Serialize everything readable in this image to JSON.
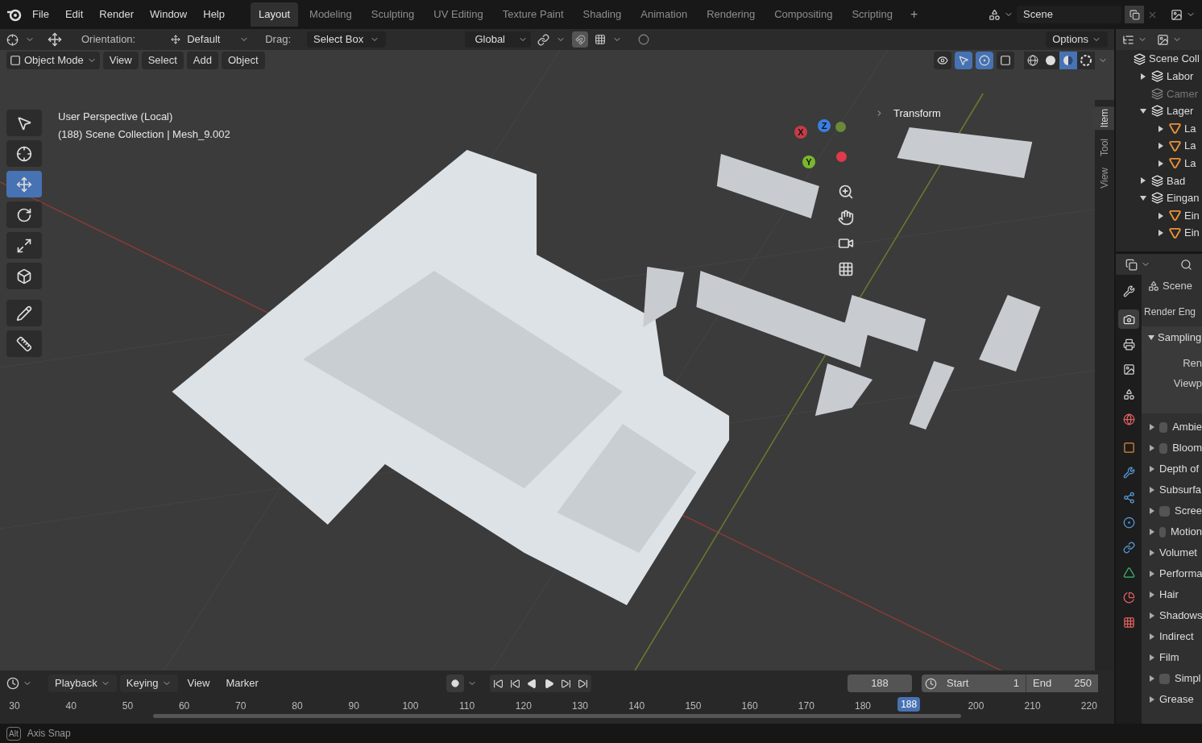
{
  "top_bar": {
    "menus": [
      "File",
      "Edit",
      "Render",
      "Window",
      "Help"
    ],
    "workspaces": [
      {
        "label": "Layout",
        "selected": true
      },
      {
        "label": "Modeling",
        "selected": false
      },
      {
        "label": "Sculpting",
        "selected": false
      },
      {
        "label": "UV Editing",
        "selected": false
      },
      {
        "label": "Texture Paint",
        "selected": false
      },
      {
        "label": "Shading",
        "selected": false
      },
      {
        "label": "Animation",
        "selected": false
      },
      {
        "label": "Rendering",
        "selected": false
      },
      {
        "label": "Compositing",
        "selected": false
      },
      {
        "label": "Scripting",
        "selected": false
      }
    ],
    "add_workspace": "+",
    "scene": "Scene"
  },
  "tool_settings": {
    "orientation_label": "Orientation:",
    "orientation": "Default",
    "drag_label": "Drag:",
    "drag": "Select Box",
    "transform_orientation": "Global",
    "snapping_on": true,
    "options": "Options"
  },
  "viewport_header": {
    "mode": "Object Mode",
    "menus": [
      "View",
      "Select",
      "Add",
      "Object"
    ],
    "toggles": [
      {
        "kind": "selectability",
        "selected": false
      },
      {
        "kind": "gizmos",
        "selected": true
      },
      {
        "kind": "overlays",
        "selected": true
      },
      {
        "kind": "xray",
        "selected": false
      }
    ],
    "shading": [
      {
        "kind": "wireframe",
        "selected": false
      },
      {
        "kind": "solid",
        "selected": false
      },
      {
        "kind": "material",
        "selected": true
      },
      {
        "kind": "rendered",
        "selected": false
      }
    ]
  },
  "toolbar": [
    {
      "kind": "select",
      "selected": false
    },
    {
      "kind": "cursor",
      "selected": false
    },
    {
      "kind": "move",
      "selected": true
    },
    {
      "kind": "rotate",
      "selected": false
    },
    {
      "kind": "scale",
      "selected": false
    },
    {
      "kind": "transform",
      "selected": false
    },
    {
      "kind": "annotate",
      "selected": false
    },
    {
      "kind": "measure",
      "selected": false
    }
  ],
  "viewport": {
    "view_name": "User Perspective (Local)",
    "info": "(188) Scene Collection | Mesh_9.002",
    "gizmo_axes": [
      "X",
      "Y",
      "Z"
    ],
    "sidebar_panel": "Transform",
    "sidebar_tabs": [
      {
        "label": "Item",
        "selected": true
      },
      {
        "label": "Tool",
        "selected": false
      },
      {
        "label": "View",
        "selected": false
      }
    ]
  },
  "outliner": {
    "root": "Scene Coll",
    "items": [
      {
        "label": "Labor",
        "kind": "collection",
        "expanded": false,
        "disabled": false
      },
      {
        "label": "Camer",
        "kind": "collection",
        "disabled": true
      },
      {
        "label": "Lager",
        "kind": "collection",
        "expanded": true,
        "disabled": false,
        "children": [
          {
            "label": "La",
            "kind": "mesh",
            "expanded": false,
            "disabled": false
          },
          {
            "label": "La",
            "kind": "mesh",
            "expanded": false,
            "disabled": false
          },
          {
            "label": "La",
            "kind": "mesh",
            "expanded": false,
            "disabled": false
          }
        ]
      },
      {
        "label": "Bad",
        "kind": "collection",
        "expanded": false,
        "disabled": false
      },
      {
        "label": "Eingan",
        "kind": "collection",
        "expanded": true,
        "disabled": false,
        "children": [
          {
            "label": "Ein",
            "kind": "mesh",
            "expanded": false,
            "disabled": false
          },
          {
            "label": "Ein",
            "kind": "mesh",
            "expanded": false,
            "disabled": false
          }
        ]
      }
    ]
  },
  "properties": {
    "tabs": [
      {
        "kind": "tool",
        "selected": false
      },
      {
        "kind": "render",
        "selected": true
      },
      {
        "kind": "output",
        "selected": false
      },
      {
        "kind": "view_layer",
        "selected": false
      },
      {
        "kind": "scene",
        "selected": false
      },
      {
        "kind": "world",
        "selected": false
      },
      {
        "kind": "object",
        "selected": false
      },
      {
        "kind": "modifiers",
        "selected": false
      },
      {
        "kind": "particles",
        "selected": false
      },
      {
        "kind": "physics",
        "selected": false
      },
      {
        "kind": "constraints",
        "selected": false
      },
      {
        "kind": "data",
        "selected": false
      },
      {
        "kind": "material",
        "selected": false
      },
      {
        "kind": "texture",
        "selected": false
      }
    ],
    "scene": "Scene",
    "render_engine_label": "Render Eng",
    "sampling": {
      "label": "Sampling",
      "expanded": true,
      "fields": [
        "Ren",
        "Viewp"
      ]
    },
    "panels": [
      {
        "label": "Ambie",
        "kind": "checkbox",
        "checked": false
      },
      {
        "label": "Bloom",
        "kind": "checkbox",
        "checked": false
      },
      {
        "label": "Depth of",
        "kind": "plain"
      },
      {
        "label": "Subsurfa",
        "kind": "plain"
      },
      {
        "label": "Scree",
        "kind": "checkbox",
        "checked": false
      },
      {
        "label": "Motion",
        "kind": "checkbox",
        "checked": false
      },
      {
        "label": "Volumet",
        "kind": "plain"
      },
      {
        "label": "Performa",
        "kind": "plain"
      },
      {
        "label": "Hair",
        "kind": "plain"
      },
      {
        "label": "Shadows",
        "kind": "plain"
      },
      {
        "label": "Indirect",
        "kind": "plain"
      },
      {
        "label": "Film",
        "kind": "plain"
      },
      {
        "label": "Simpl",
        "kind": "checkbox",
        "checked": false
      },
      {
        "label": "Grease",
        "kind": "plain"
      }
    ]
  },
  "timeline": {
    "menus": [
      {
        "label": "Playback",
        "dropdown": true
      },
      {
        "label": "Keying",
        "dropdown": true
      },
      {
        "label": "View",
        "dropdown": false
      },
      {
        "label": "Marker",
        "dropdown": false
      }
    ],
    "current_frame": "188",
    "start_label": "Start",
    "start": "1",
    "end_label": "End",
    "end": "250",
    "ruler": [
      "30",
      "40",
      "50",
      "60",
      "70",
      "80",
      "90",
      "100",
      "110",
      "120",
      "130",
      "140",
      "150",
      "160",
      "170",
      "180",
      "200",
      "210",
      "220"
    ],
    "playhead": "188"
  },
  "status_bar": {
    "key": "Alt",
    "text": "Axis Snap"
  }
}
